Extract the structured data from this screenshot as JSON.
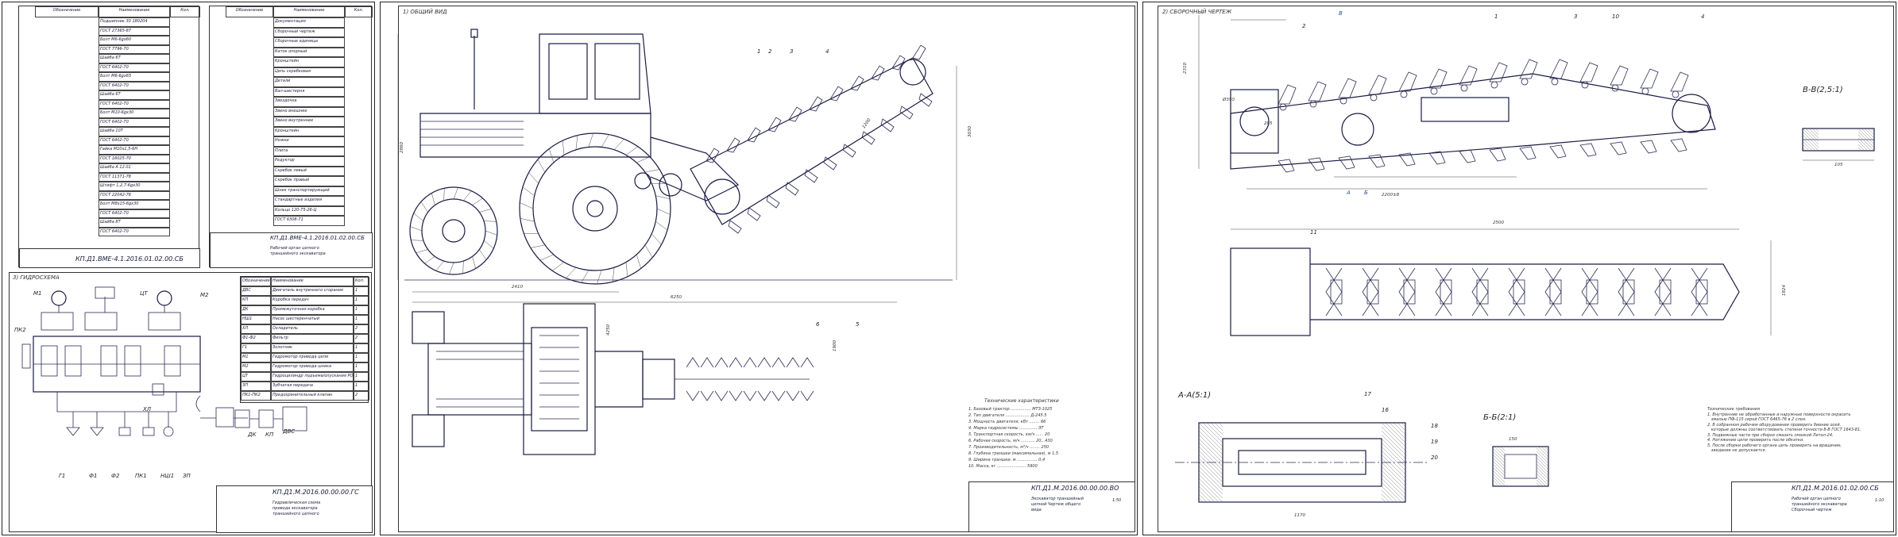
{
  "sheets": {
    "spec_left": {
      "code": "КП.Д1.ВМЕ-4.1.2016.01.02.00.СБ",
      "headers": [
        "Обозначение",
        "Наименование",
        "Кол."
      ],
      "rows": [
        "Подшипник 30 180204",
        "ГОСТ 27365-87",
        "Болт М6-6gx60",
        "ГОСТ 7796-70",
        "Шайба 6Т",
        "ГОСТ 6402-70",
        "Болт М6-6gx65",
        "ГОСТ 6402-70",
        "Шайба 6Т",
        "ГОСТ 6402-70",
        "Болт М10-6gx30",
        "ГОСТ 6402-70",
        "Шайба 10Т",
        "ГОСТ 6402-70",
        "Гайка М10х1,5-6Н",
        "ГОСТ 16025-70",
        "Шайба А 12.01",
        "ГОСТ 11371-78",
        "Штифт 1,2,7-6gx30",
        "ГОСТ 22042-76",
        "Болт М8х15-6gx30",
        "ГОСТ 6402-70",
        "Шайба 8Т",
        "ГОСТ 6402-70"
      ]
    },
    "spec_mid": {
      "code": "КП.Д1.ВМЕ-4.1.2016.01.02.00.СБ",
      "title": "Рабочий орган цепного траншейного экскаватора",
      "headers": [
        "Обозначение",
        "Наименование",
        "Кол."
      ],
      "rows": [
        "Документация",
        "Сборочный чертеж",
        "Сборочные единицы",
        "Каток опорный",
        "Кронштейн",
        "Цепь скребковая",
        "Детали",
        "Вал-шестерня",
        "Звездочка",
        "Звено внешнее",
        "Звено внутреннее",
        "Кронштейн",
        "Ножки",
        "Плита",
        "Редуктор",
        "Скребок левый",
        "Скребок правый",
        "Шнек транспортирующий",
        "Стандартные изделия",
        "Кольцо 120-75-26-Ц",
        "ГОСТ 6308-71"
      ]
    },
    "hydraulic": {
      "section_title": "3) ГИДРОСХЕМА",
      "code": "КП.Д1.М.2016.00.00.00.ГС",
      "name": "Гидравлическая схема привода экскаватора траншейного цепного",
      "labels": [
        "М1",
        "ЦТ",
        "М2",
        "ПК2",
        "ХЛ",
        "Г1",
        "Ф1",
        "Ф2",
        "ПК1",
        "НШ1",
        "ЗП",
        "ДК",
        "КП",
        "ДВС"
      ],
      "table_headers": [
        "Обозначение",
        "Наименование",
        "Кол."
      ],
      "table": [
        [
          "ДВС",
          "Двигатель внутреннего сгорания",
          "1"
        ],
        [
          "КП",
          "Коробка передач",
          "1"
        ],
        [
          "ДК",
          "Промежуточная коробка",
          "1"
        ],
        [
          "НШ1",
          "Насос шестеренчатый",
          "1"
        ],
        [
          "ХЛ",
          "Охладитель",
          "2"
        ],
        [
          "Ф1-Ф2",
          "Фильтр",
          "2"
        ],
        [
          "Г1",
          "Золотник",
          "1"
        ],
        [
          "М1",
          "Гидромотор привода цепи",
          "1"
        ],
        [
          "М2",
          "Гидромотор привода шнека",
          "1"
        ],
        [
          "ЦТ",
          "Гидроцилиндр подъема/опускания РО",
          "1"
        ],
        [
          "ЗП",
          "Зубчатая передача",
          "1"
        ],
        [
          "ПК1-ПК2",
          "Предохранительный клапан",
          "2"
        ]
      ]
    },
    "general": {
      "section_title": "1) ОБЩИЙ ВИД",
      "code": "КП.Д1.М.2016.00.00.00.ВО",
      "name": "Экскаватор траншейный цепной Чертеж общего вида",
      "scale": "1:50",
      "dims": [
        "2410",
        "6250",
        "2860",
        "3030",
        "1200",
        "4250",
        "1900"
      ],
      "callouts": [
        "1",
        "2",
        "3",
        "4",
        "5",
        "6"
      ],
      "tech_title": "Технические характеристики",
      "tech": [
        "1. Базовый трактор ................ МТЗ-1025",
        "2. Тип двигателя ................... Д-245.5",
        "3. Мощность двигателя, кВт ........ 66",
        "4. Марка гидросистемы .............. ЭТ",
        "5. Транспортная скорость, км/ч ...... 20",
        "6. Рабочая скорость, м/ч ........... 20...430",
        "7. Производительность, м³/ч ........ 250",
        "8. Глубина траншеи (максимальная), м 1,5",
        "9. Ширина траншеи, м ................ 0,4",
        "10. Масса, кг ....................... 5900"
      ]
    },
    "assembly": {
      "section_title": "2) СБОРОЧНЫЙ ЧЕРТЕЖ",
      "code": "КП.Д1.М.2016.01.02.00.СБ",
      "name": "Рабочий орган цепного траншейного экскаватора Сборочный чертеж",
      "scale": "1:10",
      "views": [
        "В-В(2,5:1)",
        "А-А(5:1)",
        "Б-Б(2:1)",
        "В",
        "А",
        "Б"
      ],
      "dims": [
        "2310",
        "Ø350",
        "2500",
        "1824",
        "1470",
        "285",
        "2200±8",
        "105",
        "1170",
        "1875",
        "150"
      ],
      "callouts": [
        "1",
        "2",
        "3",
        "4",
        "5",
        "7",
        "8",
        "9",
        "10",
        "11",
        "16",
        "17",
        "18",
        "19",
        "20",
        "21",
        "22",
        "23",
        "24",
        "25",
        "26",
        "27"
      ],
      "notes": "Технические требования\n1. Внутренние не обработанные и наружные поверхности окрасить\n   эмалью ПФ-115 серой ГОСТ 6465-76 в 2 слоя.\n2. В собранном рабочем оборудовании проверить биение осей,\n   которые должны соответствовать степени точности 8-В ГОСТ 1643-81.\n3. Подвижные части при сборке смазать смазкой Литол-24.\n4. Натяжение цепи проверить после обкатки.\n5. После сборки рабочего органа цепь проверить на вращение,\n   заедание не допускается."
    }
  }
}
